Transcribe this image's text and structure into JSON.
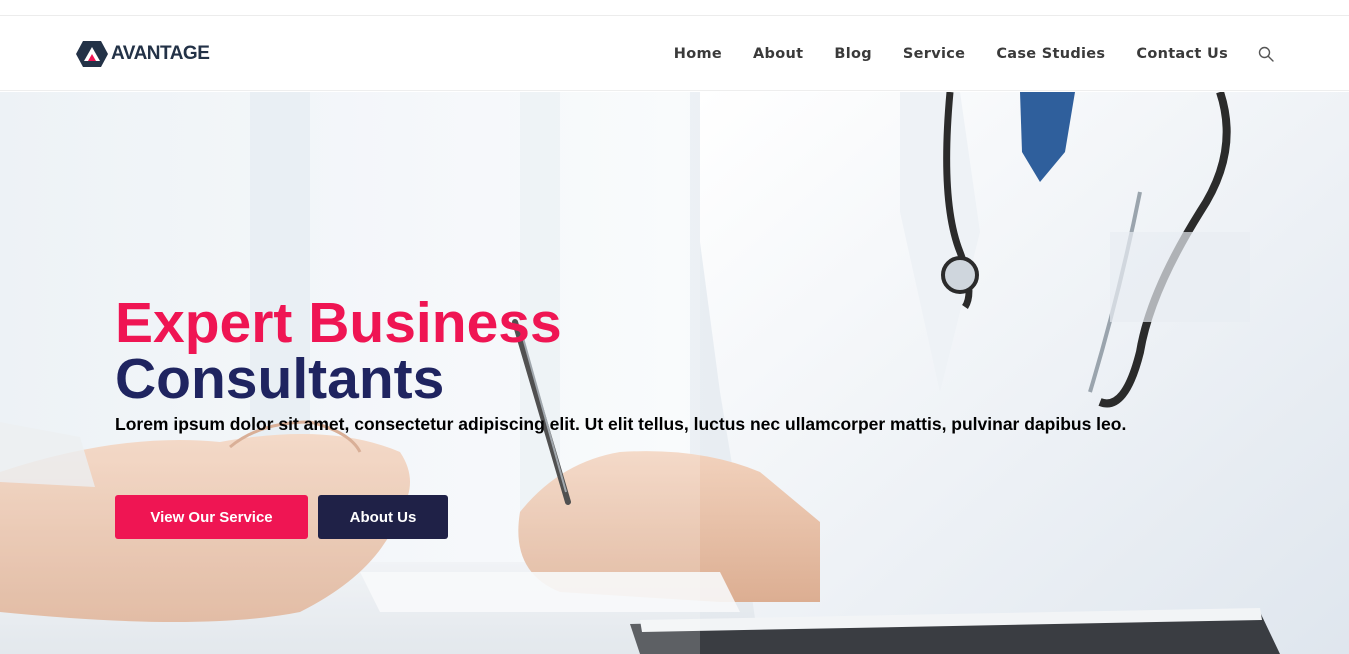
{
  "brand": {
    "name": "AVANTAGE"
  },
  "nav": {
    "items": [
      "Home",
      "About",
      "Blog",
      "Service",
      "Case Studies",
      "Contact Us"
    ]
  },
  "hero": {
    "title_line1": "Expert Business",
    "title_line2": "Consultants",
    "description": "Lorem ipsum dolor sit amet, consectetur adipiscing elit. Ut elit tellus, luctus nec ullamcorper mattis, pulvinar dapibus leo.",
    "primary_button": "View Our Service",
    "secondary_button": "About Us"
  },
  "colors": {
    "accent": "#ef1553",
    "navy": "#1f2460",
    "button_dark": "#1f2147",
    "nav_text": "#3a3a3a"
  },
  "icons": {
    "logo": "avantage-hexagon-logo",
    "search": "search-icon"
  }
}
